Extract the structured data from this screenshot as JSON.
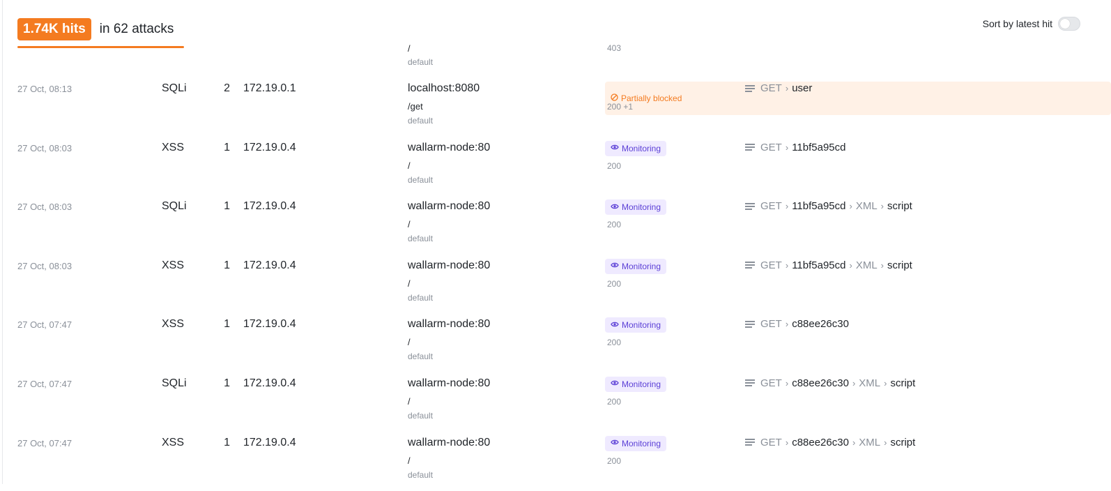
{
  "summary": {
    "hits": "1.74K hits",
    "attacks": "in 62 attacks"
  },
  "sort_toggle": {
    "label": "Sort by latest hit",
    "on": false
  },
  "partial_row": {
    "path": "/",
    "code": "403",
    "application": "default"
  },
  "rows": [
    {
      "time": "27 Oct, 08:13",
      "type": "SQLi",
      "hits": "2",
      "ip": "172.19.0.1",
      "host": "localhost:8080",
      "path": "/get",
      "application": "default",
      "status": "Partially blocked",
      "status_kind": "partial",
      "codes": "200 +1",
      "method": "GET",
      "p1": "user",
      "p2": "",
      "p3": ""
    },
    {
      "time": "27 Oct, 08:03",
      "type": "XSS",
      "hits": "1",
      "ip": "172.19.0.4",
      "host": "wallarm-node:80",
      "path": "/",
      "application": "default",
      "status": "Monitoring",
      "status_kind": "monitoring",
      "codes": "200",
      "method": "GET",
      "p1": "11bf5a95cd",
      "p2": "",
      "p3": ""
    },
    {
      "time": "27 Oct, 08:03",
      "type": "SQLi",
      "hits": "1",
      "ip": "172.19.0.4",
      "host": "wallarm-node:80",
      "path": "/",
      "application": "default",
      "status": "Monitoring",
      "status_kind": "monitoring",
      "codes": "200",
      "method": "GET",
      "p1": "11bf5a95cd",
      "p2": "XML",
      "p3": "script"
    },
    {
      "time": "27 Oct, 08:03",
      "type": "XSS",
      "hits": "1",
      "ip": "172.19.0.4",
      "host": "wallarm-node:80",
      "path": "/",
      "application": "default",
      "status": "Monitoring",
      "status_kind": "monitoring",
      "codes": "200",
      "method": "GET",
      "p1": "11bf5a95cd",
      "p2": "XML",
      "p3": "script"
    },
    {
      "time": "27 Oct, 07:47",
      "type": "XSS",
      "hits": "1",
      "ip": "172.19.0.4",
      "host": "wallarm-node:80",
      "path": "/",
      "application": "default",
      "status": "Monitoring",
      "status_kind": "monitoring",
      "codes": "200",
      "method": "GET",
      "p1": "c88ee26c30",
      "p2": "",
      "p3": ""
    },
    {
      "time": "27 Oct, 07:47",
      "type": "SQLi",
      "hits": "1",
      "ip": "172.19.0.4",
      "host": "wallarm-node:80",
      "path": "/",
      "application": "default",
      "status": "Monitoring",
      "status_kind": "monitoring",
      "codes": "200",
      "method": "GET",
      "p1": "c88ee26c30",
      "p2": "XML",
      "p3": "script"
    },
    {
      "time": "27 Oct, 07:47",
      "type": "XSS",
      "hits": "1",
      "ip": "172.19.0.4",
      "host": "wallarm-node:80",
      "path": "/",
      "application": "default",
      "status": "Monitoring",
      "status_kind": "monitoring",
      "codes": "200",
      "method": "GET",
      "p1": "c88ee26c30",
      "p2": "XML",
      "p3": "script"
    }
  ],
  "icons": {
    "request": "request-lines-icon",
    "monitoring": "eye-icon",
    "partial": "block-circle-icon",
    "separator": "chevron-right-icon"
  },
  "colors": {
    "accent": "#f47b20",
    "monitoring": "#5b3fd6",
    "monitoring_bg": "#efeaff",
    "partial_bg": "#fff1e6",
    "muted": "#8a9099"
  }
}
